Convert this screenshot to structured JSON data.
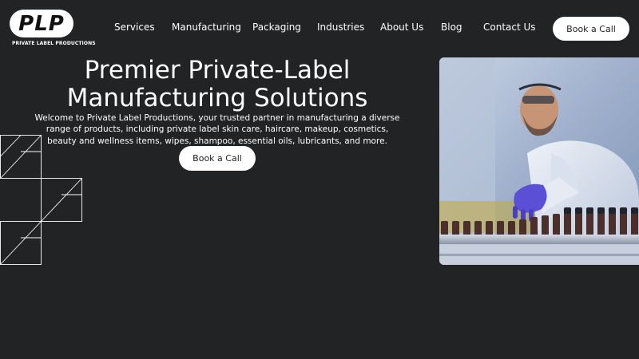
{
  "brand": {
    "logo_letters": "PLP",
    "logo_subtitle": "PRIVATE LABEL PRODUCTIONS"
  },
  "nav": {
    "items": [
      {
        "label": "Services"
      },
      {
        "label": "Manufacturing"
      },
      {
        "label": "Packaging"
      },
      {
        "label": "Industries"
      },
      {
        "label": "About Us"
      },
      {
        "label": "Blog"
      },
      {
        "label": "Contact Us"
      }
    ],
    "cta_label": "Book a Call"
  },
  "hero": {
    "title": "Premier Private-Label Manufacturing Solutions",
    "description": "Welcome to Private Label Productions, your trusted partner in manufacturing a diverse range of products, including private label skin care, haircare, makeup, cosmetics, beauty and wellness items, wipes, shampoo, essential oils, lubricants, and more.",
    "cta_label": "Book a Call"
  },
  "colors": {
    "background": "#222325",
    "button_bg": "#ffffff",
    "glove": "#5b4fd6"
  }
}
